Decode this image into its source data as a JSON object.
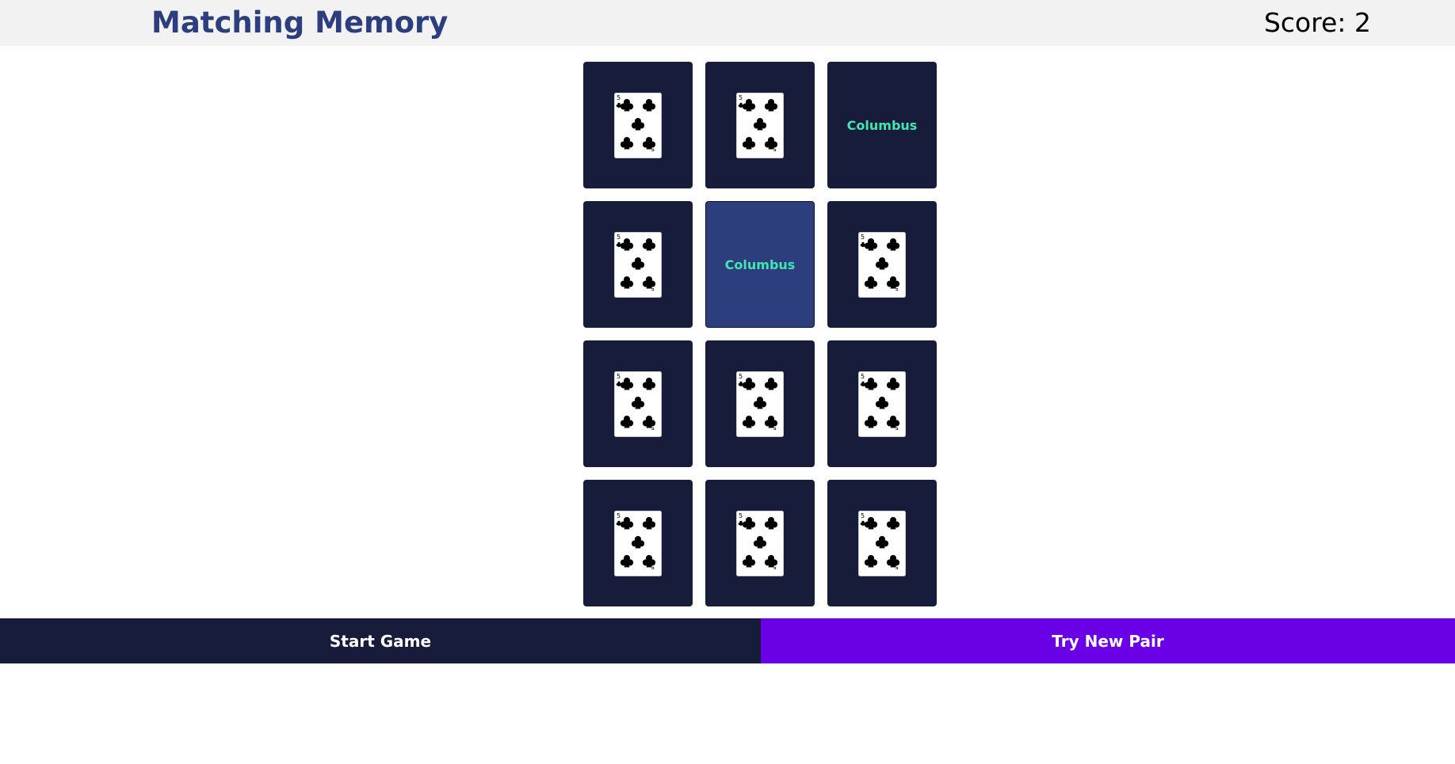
{
  "header": {
    "title": "Matching Memory",
    "score_label": "Score: 2"
  },
  "board": {
    "tiles": [
      {
        "state": "card",
        "face": "five-of-clubs",
        "rank": "5"
      },
      {
        "state": "card",
        "face": "five-of-clubs",
        "rank": "5"
      },
      {
        "state": "text",
        "text": "Columbus"
      },
      {
        "state": "card",
        "face": "five-of-clubs",
        "rank": "5"
      },
      {
        "state": "text-selected",
        "text": "Columbus"
      },
      {
        "state": "card",
        "face": "five-of-clubs",
        "rank": "5"
      },
      {
        "state": "card",
        "face": "five-of-clubs",
        "rank": "5"
      },
      {
        "state": "card",
        "face": "five-of-clubs",
        "rank": "5"
      },
      {
        "state": "card",
        "face": "five-of-clubs",
        "rank": "5"
      },
      {
        "state": "card",
        "face": "five-of-clubs",
        "rank": "5"
      },
      {
        "state": "card",
        "face": "five-of-clubs",
        "rank": "5"
      },
      {
        "state": "card",
        "face": "five-of-clubs",
        "rank": "5"
      }
    ]
  },
  "footer": {
    "start_label": "Start Game",
    "new_pair_label": "Try New Pair"
  },
  "colors": {
    "header_bg": "#f2f2f2",
    "title": "#2c3e7e",
    "tile_bg": "#161c3a",
    "tile_selected_bg": "#2c3e7e",
    "tile_text": "#41e6b1",
    "start_button_bg": "#161c3a",
    "new_pair_button_bg": "#6900e6"
  }
}
